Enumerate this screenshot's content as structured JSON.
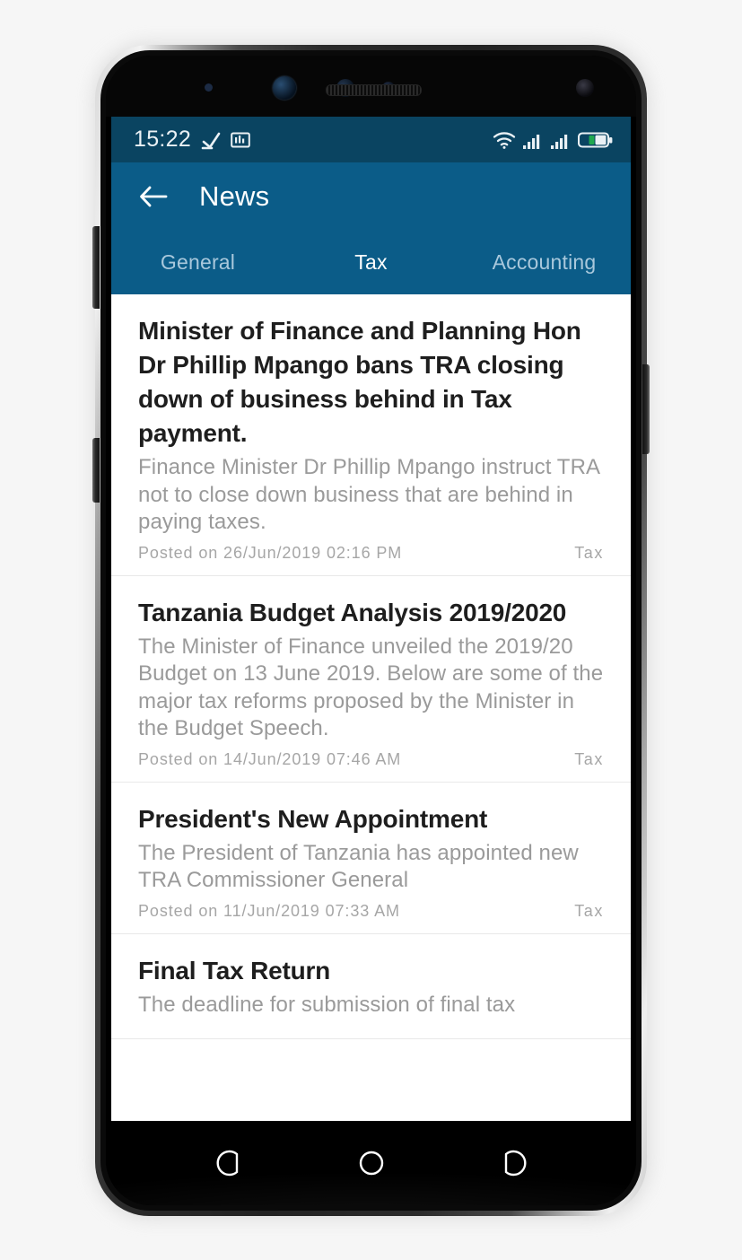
{
  "status_bar": {
    "time": "15:22",
    "icons_left": [
      "download-complete-icon",
      "app-badge-icon"
    ],
    "icons_right": [
      "wifi-icon",
      "signal-sim1-icon",
      "signal-sim2-icon",
      "battery-icon"
    ],
    "background_color": "#0a4461",
    "battery_fill_color": "#18a34a"
  },
  "app_bar": {
    "back_icon": "back-arrow-icon",
    "title": "News",
    "background_color": "#0b5c88"
  },
  "tabs": {
    "items": [
      {
        "label": "General",
        "active": false
      },
      {
        "label": "Tax",
        "active": true
      },
      {
        "label": "Accounting",
        "active": false
      }
    ]
  },
  "news": {
    "articles": [
      {
        "title": "Minister of Finance and Planning Hon Dr Phillip Mpango bans TRA closing down of business behind in Tax payment.",
        "summary": "Finance Minister Dr Phillip Mpango instruct TRA not to close down business that are behind in paying taxes.",
        "posted": "Posted on 26/Jun/2019 02:16 PM",
        "category": "Tax"
      },
      {
        "title": "Tanzania Budget Analysis 2019/2020",
        "summary": "The Minister of Finance unveiled the 2019/20 Budget on 13 June 2019. Below are some of the major tax reforms proposed by the Minister in the Budget Speech.",
        "posted": "Posted on 14/Jun/2019 07:46 AM",
        "category": "Tax"
      },
      {
        "title": "President's New Appointment",
        "summary": "The President of Tanzania has appointed new TRA Commissioner General",
        "posted": "Posted on 11/Jun/2019 07:33 AM",
        "category": "Tax"
      },
      {
        "title": "Final Tax Return",
        "summary": "The deadline for submission of final tax",
        "posted": "",
        "category": ""
      }
    ]
  },
  "nav_bar": {
    "buttons": [
      "back-nav-icon",
      "home-nav-icon",
      "recents-nav-icon"
    ],
    "background_color": "#000000"
  }
}
